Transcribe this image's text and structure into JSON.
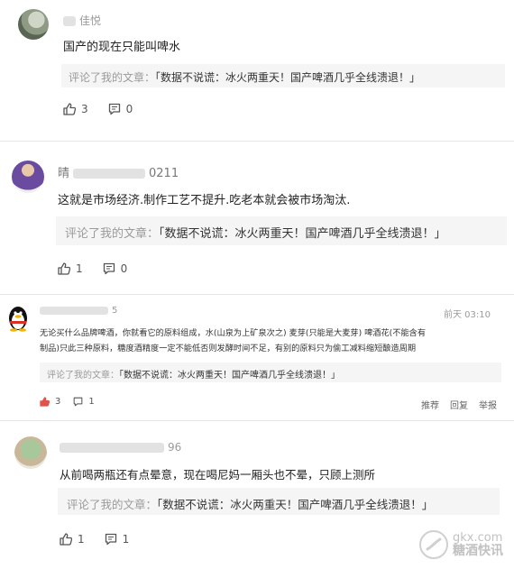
{
  "comments": [
    {
      "name": "佳悦",
      "text": "国产的现在只能叫啤水",
      "quote_prefix": "评论了我的文章：",
      "quote_title": "「数据不说谎：冰火两重天！国产啤酒几乎全线溃退！」",
      "likes": "3",
      "replies": "0"
    },
    {
      "name": "晴",
      "name_tail": "0211",
      "text": "这就是市场经济.制作工艺不提升.吃老本就会被市场淘汰.",
      "quote_prefix": "评论了我的文章：",
      "quote_title": "「数据不说谎：冰火两重天！国产啤酒几乎全线溃退！」",
      "likes": "1",
      "replies": "0"
    },
    {
      "name_tail": "5",
      "time": "前天 03:10",
      "text_line1": "无论买什么品牌啤酒，你就看它的原料组成，水(山泉为上矿泉次之) 麦芽(只能是大麦芽) 啤酒花(不能含有",
      "text_line2": "制品)只此三种原料，糖度酒精度一定不能低否则发酵时间不足，有别的原料只为偷工减料缩短酿造周期",
      "quote_prefix": "评论了我的文章：",
      "quote_title": "「数据不说谎：冰火两重天！国产啤酒几乎全线溃退！」",
      "likes": "3",
      "replies": "1",
      "links": [
        "推荐",
        "回复",
        "举报"
      ]
    },
    {
      "name_tail": "96",
      "text": "从前喝两瓶还有点晕意，现在喝尼妈一厢头也不晕，只顾上测所",
      "quote_prefix": "评论了我的文章：",
      "quote_title": "「数据不说谎：冰火两重天！国产啤酒几乎全线溃退！」",
      "likes": "1",
      "replies": "1"
    }
  ],
  "watermark": {
    "line1": "gkx.com",
    "line2": "糖酒快讯"
  },
  "colors": {
    "quote_bg": "#f5f5f5",
    "muted": "#9a9a9a",
    "text": "#222222"
  }
}
